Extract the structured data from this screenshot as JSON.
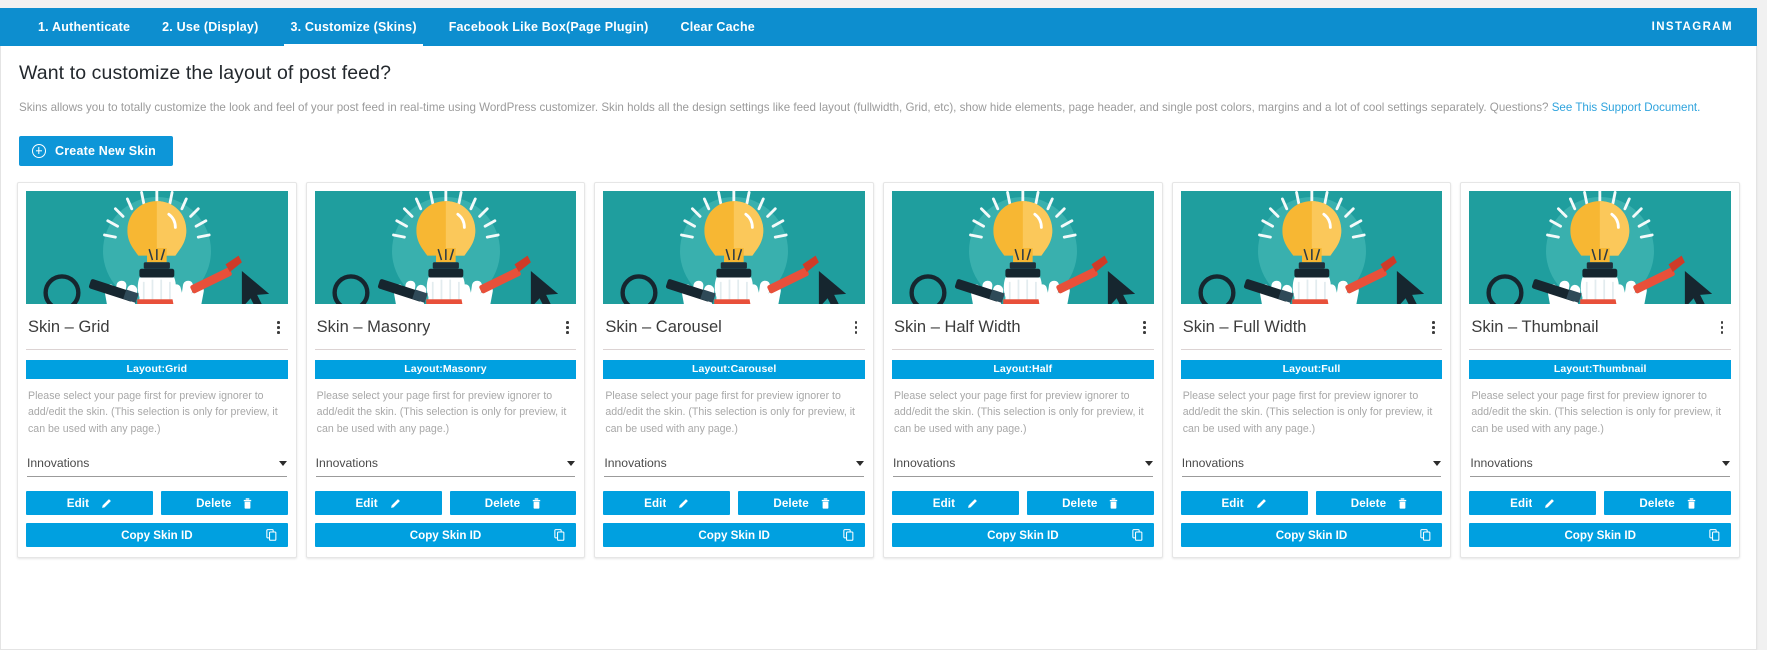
{
  "nav": {
    "items": [
      {
        "label": "1. Authenticate",
        "active": false
      },
      {
        "label": "2. Use (Display)",
        "active": false
      },
      {
        "label": "3. Customize (Skins)",
        "active": true
      },
      {
        "label": "Facebook Like Box(Page Plugin)",
        "active": false
      },
      {
        "label": "Clear Cache",
        "active": false
      }
    ],
    "brand": "INSTAGRAM"
  },
  "header": {
    "title": "Want to customize the layout of post feed?",
    "intro_text": "Skins allows you to totally customize the look and feel of your post feed in real-time using WordPress customizer. Skin holds all the design settings like feed layout (fullwidth, Grid, etc), show hide elements, page header, and single post colors, margins and a lot of cool settings separately. Questions? ",
    "intro_link": "See This Support Document.",
    "create_button": "Create New Skin",
    "create_icon": "plus-circle-icon"
  },
  "common": {
    "hint": "Please select your page first for preview ignorer to add/edit the skin. (This selection is only for preview, it can be used with any page.)",
    "select_value": "Innovations",
    "edit_label": "Edit",
    "edit_icon": "pencil-icon",
    "delete_label": "Delete",
    "delete_icon": "trash-icon",
    "copy_label": "Copy Skin ID",
    "copy_icon": "copy-icon",
    "kebab_icon": "more-vertical-icon",
    "caret_icon": "chevron-down-icon",
    "thumbnail_icon": "lightbulb-idea-illustration"
  },
  "colors": {
    "nav_blue": "#0d8ecf",
    "button_blue": "#00a0e0",
    "create_blue": "#0d96d8",
    "link_blue": "#2ea3dd",
    "thumb_teal": "#1f9e9e",
    "thumb_glow": "#39b0ae"
  },
  "cards": [
    {
      "title": "Skin – Grid",
      "layout": "Layout:Grid"
    },
    {
      "title": "Skin – Masonry",
      "layout": "Layout:Masonry"
    },
    {
      "title": "Skin – Carousel",
      "layout": "Layout:Carousel"
    },
    {
      "title": "Skin – Half Width",
      "layout": "Layout:Half"
    },
    {
      "title": "Skin – Full Width",
      "layout": "Layout:Full"
    },
    {
      "title": "Skin – Thumbnail",
      "layout": "Layout:Thumbnail"
    }
  ]
}
